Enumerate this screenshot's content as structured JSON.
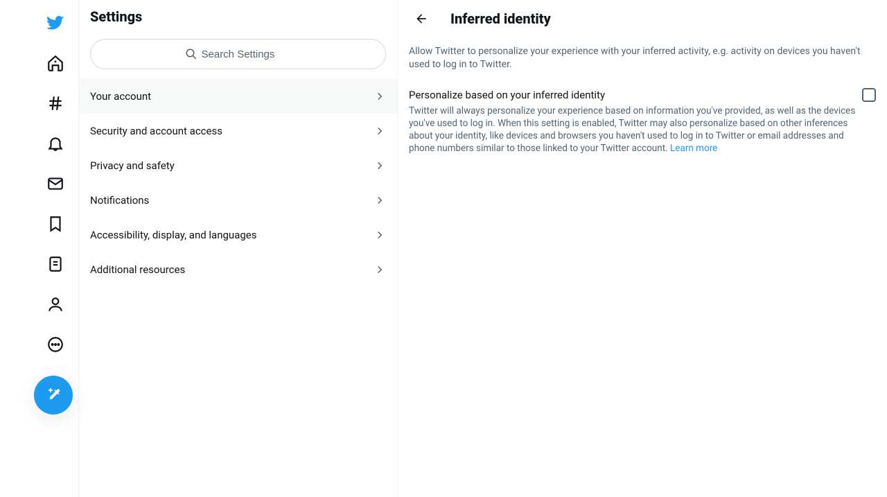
{
  "nav": {
    "icons": [
      "twitter-logo",
      "home",
      "explore",
      "notifications",
      "messages",
      "bookmarks",
      "lists",
      "profile",
      "more"
    ],
    "compose": "compose"
  },
  "settings": {
    "title": "Settings",
    "search_placeholder": "Search Settings",
    "items": [
      {
        "label": "Your account",
        "active": true
      },
      {
        "label": "Security and account access",
        "active": false
      },
      {
        "label": "Privacy and safety",
        "active": false
      },
      {
        "label": "Notifications",
        "active": false
      },
      {
        "label": "Accessibility, display, and languages",
        "active": false
      },
      {
        "label": "Additional resources",
        "active": false
      }
    ]
  },
  "detail": {
    "title": "Inferred identity",
    "description": "Allow Twitter to personalize your experience with your inferred activity, e.g. activity on devices you haven't used to log in to Twitter.",
    "option": {
      "title": "Personalize based on your inferred identity",
      "body": "Twitter will always personalize your experience based on information you've provided, as well as the devices you've used to log in. When this setting is enabled, Twitter may also personalize based on other inferences about your identity, like devices and browsers you haven't used to log in to Twitter or email addresses and phone numbers similar to those linked to your Twitter account. ",
      "learn_more": "Learn more",
      "checked": false
    }
  }
}
